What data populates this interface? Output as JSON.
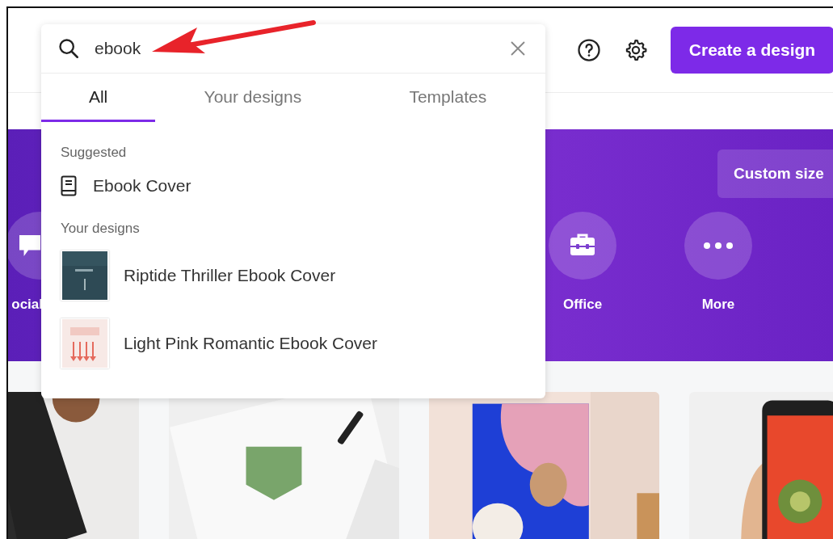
{
  "header": {
    "create_button": "Create a design"
  },
  "hero": {
    "custom_size_button": "Custom size",
    "categories": [
      {
        "label": "ocial"
      },
      {
        "label": "Office"
      },
      {
        "label": "More"
      }
    ]
  },
  "search": {
    "query": "ebook",
    "tabs": [
      {
        "label": "All",
        "selected": true
      },
      {
        "label": "Your designs",
        "selected": false
      },
      {
        "label": "Templates",
        "selected": false
      }
    ],
    "sections": [
      {
        "heading": "Suggested",
        "items": [
          {
            "kind": "suggestion",
            "label": "Ebook Cover"
          }
        ]
      },
      {
        "heading": "Your designs",
        "items": [
          {
            "kind": "design",
            "label": "Riptide Thriller Ebook Cover"
          },
          {
            "kind": "design",
            "label": "Light Pink Romantic Ebook Cover"
          }
        ]
      }
    ]
  }
}
